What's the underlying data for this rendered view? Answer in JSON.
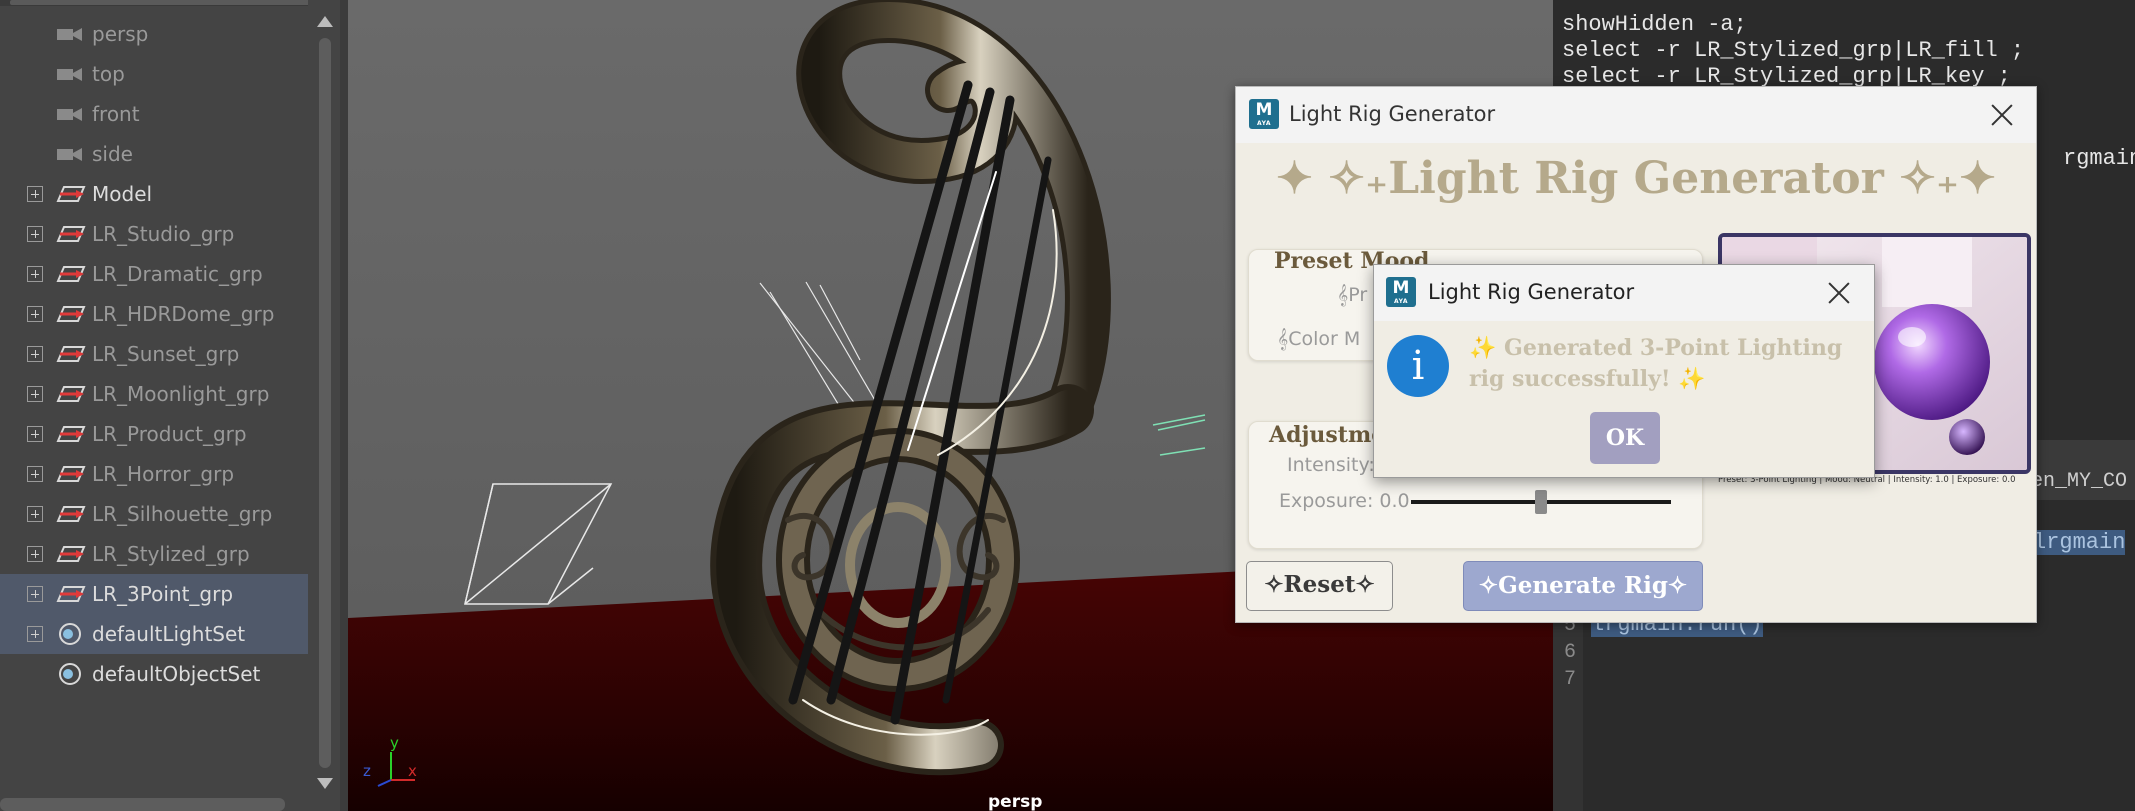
{
  "outliner": {
    "items": [
      {
        "label": "persp",
        "icon": "camera-icon",
        "expandable": false,
        "style": "dim",
        "selected": false
      },
      {
        "label": "top",
        "icon": "camera-icon",
        "expandable": false,
        "style": "dim",
        "selected": false
      },
      {
        "label": "front",
        "icon": "camera-icon",
        "expandable": false,
        "style": "dim",
        "selected": false
      },
      {
        "label": "side",
        "icon": "camera-icon",
        "expandable": false,
        "style": "dim",
        "selected": false
      },
      {
        "label": "Model",
        "icon": "group-icon",
        "expandable": true,
        "style": "bright",
        "selected": false
      },
      {
        "label": "LR_Studio_grp",
        "icon": "group-icon",
        "expandable": true,
        "style": "dim",
        "selected": false
      },
      {
        "label": "LR_Dramatic_grp",
        "icon": "group-icon",
        "expandable": true,
        "style": "dim",
        "selected": false
      },
      {
        "label": "LR_HDRDome_grp",
        "icon": "group-icon",
        "expandable": true,
        "style": "dim",
        "selected": false
      },
      {
        "label": "LR_Sunset_grp",
        "icon": "group-icon",
        "expandable": true,
        "style": "dim",
        "selected": false
      },
      {
        "label": "LR_Moonlight_grp",
        "icon": "group-icon",
        "expandable": true,
        "style": "dim",
        "selected": false
      },
      {
        "label": "LR_Product_grp",
        "icon": "group-icon",
        "expandable": true,
        "style": "dim",
        "selected": false
      },
      {
        "label": "LR_Horror_grp",
        "icon": "group-icon",
        "expandable": true,
        "style": "dim",
        "selected": false
      },
      {
        "label": "LR_Silhouette_grp",
        "icon": "group-icon",
        "expandable": true,
        "style": "dim",
        "selected": false
      },
      {
        "label": "LR_Stylized_grp",
        "icon": "group-icon",
        "expandable": true,
        "style": "dim",
        "selected": false
      },
      {
        "label": "LR_3Point_grp",
        "icon": "group-icon",
        "expandable": true,
        "style": "bright",
        "selected": true
      },
      {
        "label": "defaultLightSet",
        "icon": "set-icon",
        "expandable": true,
        "style": "bright",
        "selected": true
      },
      {
        "label": "defaultObjectSet",
        "icon": "set-icon",
        "expandable": false,
        "style": "bright",
        "selected": false
      }
    ]
  },
  "viewport": {
    "camera_label": "persp",
    "axis": {
      "x": "x",
      "y": "y",
      "z": "z"
    }
  },
  "script_editor": {
    "history": [
      "showHidden -a;",
      "select -r LR_Stylized_grp|LR_fill ;",
      "select -r LR_Stylized_grp|LR_key ;"
    ],
    "history_fragment": "rgmain",
    "tab_fragment": "en_MY_CO",
    "code_line_fragment": "lrgmain",
    "code_lines": [
      {
        "num": "5",
        "text": "lrgmain.run()",
        "highlight": true
      },
      {
        "num": "6",
        "text": "",
        "highlight": false
      },
      {
        "num": "7",
        "text": "",
        "highlight": false
      }
    ]
  },
  "dialog": {
    "window_title": "Light Rig Generator",
    "logo_letter": "M",
    "logo_sub": "AYA",
    "header": "✦ ✧₊Light Rig Generator ✧₊✦",
    "preset_section": {
      "title": "Preset  Mood",
      "preset_label": "𝄞Pr",
      "color_label": "𝄞Color M"
    },
    "adjust_section": {
      "title": "Adjustme",
      "intensity_label": "Intensity:",
      "exposure_label": "Exposure: 0.0",
      "exposure_value": 0.5
    },
    "preview_caption": "Preset: 3-Point Lighting | Mood: Neutral | Intensity: 1.0 | Exposure: 0.0",
    "reset_label": "✧Reset✧",
    "generate_label": "✧Generate Rig✧"
  },
  "message_box": {
    "title": "Light Rig Generator",
    "logo_letter": "M",
    "logo_sub": "AYA",
    "info_glyph": "i",
    "message": "✨ Generated 3-Point Lighting rig successfully! ✨",
    "ok_label": "OK"
  }
}
